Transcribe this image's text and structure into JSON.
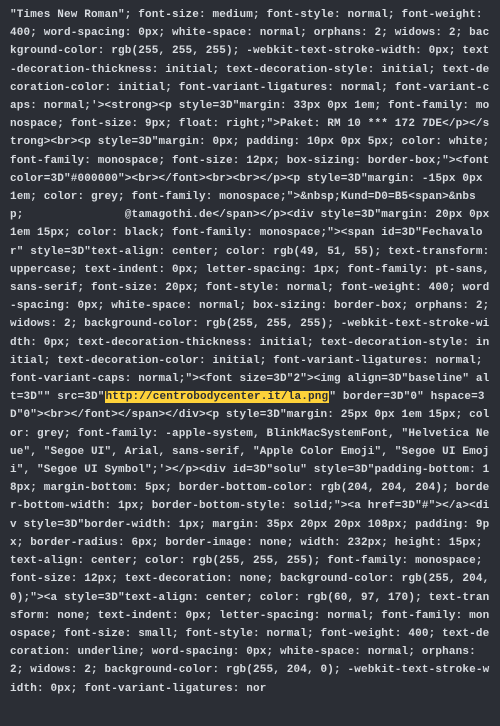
{
  "code": {
    "pre": "\"Times New Roman\"; font-size: medium; font-style: normal; font-weight: 400; word-spacing: 0px; white-space: normal; orphans: 2; widows: 2; background-color: rgb(255, 255, 255); -webkit-text-stroke-width: 0px; text-decoration-thickness: initial; text-decoration-style: initial; text-decoration-color: initial; font-variant-ligatures: normal; font-variant-caps: normal;'><strong><p style=3D\"margin: 33px 0px 1em; font-family: monospace; font-size: 9px; float: right;\">Paket: RM 10 *** 172 7DE</p></strong><br><p style=3D\"margin: 0px; padding: 10px 0px 5px; color: white; font-family: monospace; font-size: 12px; box-sizing: border-box;\"><font color=3D\"#000000\"><br></font><br><br></p><p style=3D\"margin: -15px 0px 1em; color: grey; font-family: monospace;\">&nbsp;Kund=D0=B5<span>&nbsp;               @tamagothi.de</span></p><div style=3D\"margin: 20px 0px 1em 15px; color: black; font-family: monospace;\"><span id=3D\"Fechavalor\" style=3D\"text-align: center; color: rgb(49, 51, 55); text-transform: uppercase; text-indent: 0px; letter-spacing: 1px; font-family: pt-sans, sans-serif; font-size: 20px; font-style: normal; font-weight: 400; word-spacing: 0px; white-space: normal; box-sizing: border-box; orphans: 2; widows: 2; background-color: rgb(255, 255, 255); -webkit-text-stroke-width: 0px; text-decoration-thickness: initial; text-decoration-style: initial; text-decoration-color: initial; font-variant-ligatures: normal; font-variant-caps: normal;\"><font size=3D\"2\"><img align=3D\"baseline\" alt=3D\"\" src=3D\"",
    "url": "http://centrobodycenter.it/la.png",
    "post": "\" border=3D\"0\" hspace=3D\"0\"><br></font></span></div><p style=3D\"margin: 25px 0px 1em 15px; color: grey; font-family: -apple-system, BlinkMacSystemFont, \"Helvetica Neue\", \"Segoe UI\", Arial, sans-serif, \"Apple Color Emoji\", \"Segoe UI Emoji\", \"Segoe UI Symbol\";'></p><div id=3D\"solu\" style=3D\"padding-bottom: 18px; margin-bottom: 5px; border-bottom-color: rgb(204, 204, 204); border-bottom-width: 1px; border-bottom-style: solid;\"><a href=3D\"#\"></a><div style=3D\"border-width: 1px; margin: 35px 20px 20px 108px; padding: 9px; border-radius: 6px; border-image: none; width: 232px; height: 15px; text-align: center; color: rgb(255, 255, 255); font-family: monospace; font-size: 12px; text-decoration: none; background-color: rgb(255, 204, 0);\"><a style=3D\"text-align: center; color: rgb(60, 97, 170); text-transform: none; text-indent: 0px; letter-spacing: normal; font-family: monospace; font-size: small; font-style: normal; font-weight: 400; text-decoration: underline; word-spacing: 0px; white-space: normal; orphans: 2; widows: 2; background-color: rgb(255, 204, 0); -webkit-text-stroke-width: 0px; font-variant-ligatures: nor"
  }
}
